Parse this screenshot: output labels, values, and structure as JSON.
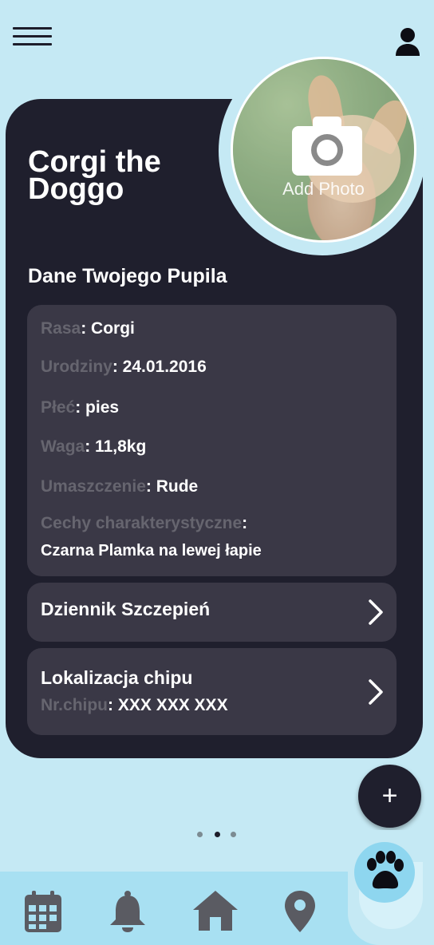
{
  "header": {
    "menu_icon": "hamburger-menu-icon",
    "profile_icon": "user-icon"
  },
  "pet": {
    "name": "Corgi the\nDoggo",
    "photo_label": "Add Photo",
    "photo_icon": "camera-icon"
  },
  "details": {
    "section_title": "Dane Twojego Pupila",
    "rows": [
      {
        "key": "Rasa",
        "value": ": Corgi"
      },
      {
        "key": "Urodziny",
        "value": ": 24.01.2016"
      },
      {
        "key": "Płeć",
        "value": ": pies"
      },
      {
        "key": "Waga",
        "value": ": 11,8kg"
      },
      {
        "key": "Umaszczenie",
        "value": ": Rude"
      },
      {
        "key": "Cechy charakterystyczne",
        "value": ":"
      }
    ],
    "traits_value": "Czarna Plamka na lewej łapie"
  },
  "vaccination": {
    "label": "Dziennik Szczepień",
    "icon": "chevron-right-icon"
  },
  "chip": {
    "label": "Lokalizacja chipu",
    "number_key": "Nr.chipu",
    "number_value": ": XXX XXX XXX",
    "icon": "chevron-right-icon"
  },
  "fab": {
    "label": "+"
  },
  "pager": {
    "count": 3,
    "active_index": 1
  },
  "bottom_nav": {
    "items": [
      "calendar-icon",
      "bell-icon",
      "home-icon",
      "location-pin-icon",
      "paw-icon"
    ],
    "active": "paw-icon"
  },
  "colors": {
    "background": "#c5e9f4",
    "card": "#1f1f2d",
    "panel": "#3a3846",
    "muted_text": "#66656f",
    "nav_bar": "#a8e0f2"
  }
}
